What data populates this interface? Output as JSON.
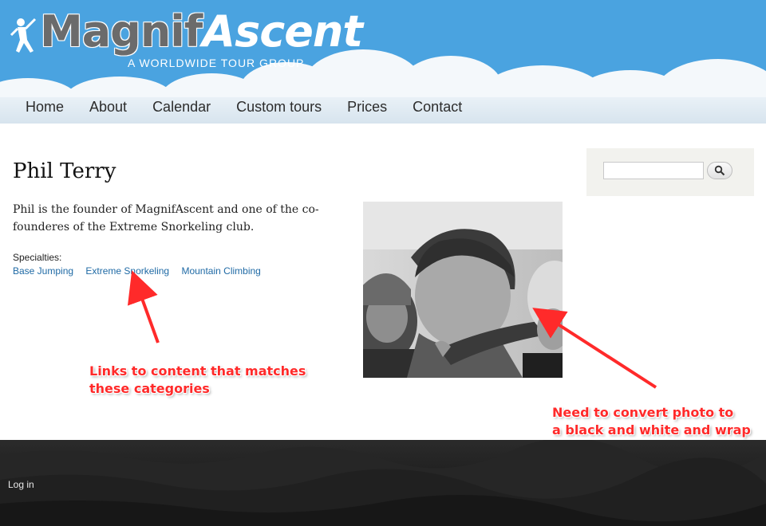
{
  "header": {
    "logo_text_a": "Magnif",
    "logo_text_b": "Ascent",
    "tagline": "A WORLDWIDE TOUR GROUP"
  },
  "nav": {
    "items": [
      "Home",
      "About",
      "Calendar",
      "Custom tours",
      "Prices",
      "Contact"
    ]
  },
  "profile": {
    "name": "Phil Terry",
    "bio": "Phil is the founder of MagnifAscent and one of the co-founderes of the Extreme Snorkeling club.",
    "specialties_label": "Specialties:",
    "specialties": [
      "Base Jumping",
      "Extreme Snorkeling",
      "Mountain Climbing"
    ]
  },
  "search": {
    "value": "",
    "button_icon": "search-icon"
  },
  "annotations": {
    "links_note": "Links to content that matches\nthese categories",
    "photo_note": "Need to convert photo to\na black and white and wrap\ntext around it."
  },
  "footer": {
    "login": "Log in"
  },
  "colors": {
    "sky": "#4aa3e0",
    "link": "#1f6aa5",
    "annotation": "#ff2a2a",
    "footer": "#1b1b1b"
  }
}
